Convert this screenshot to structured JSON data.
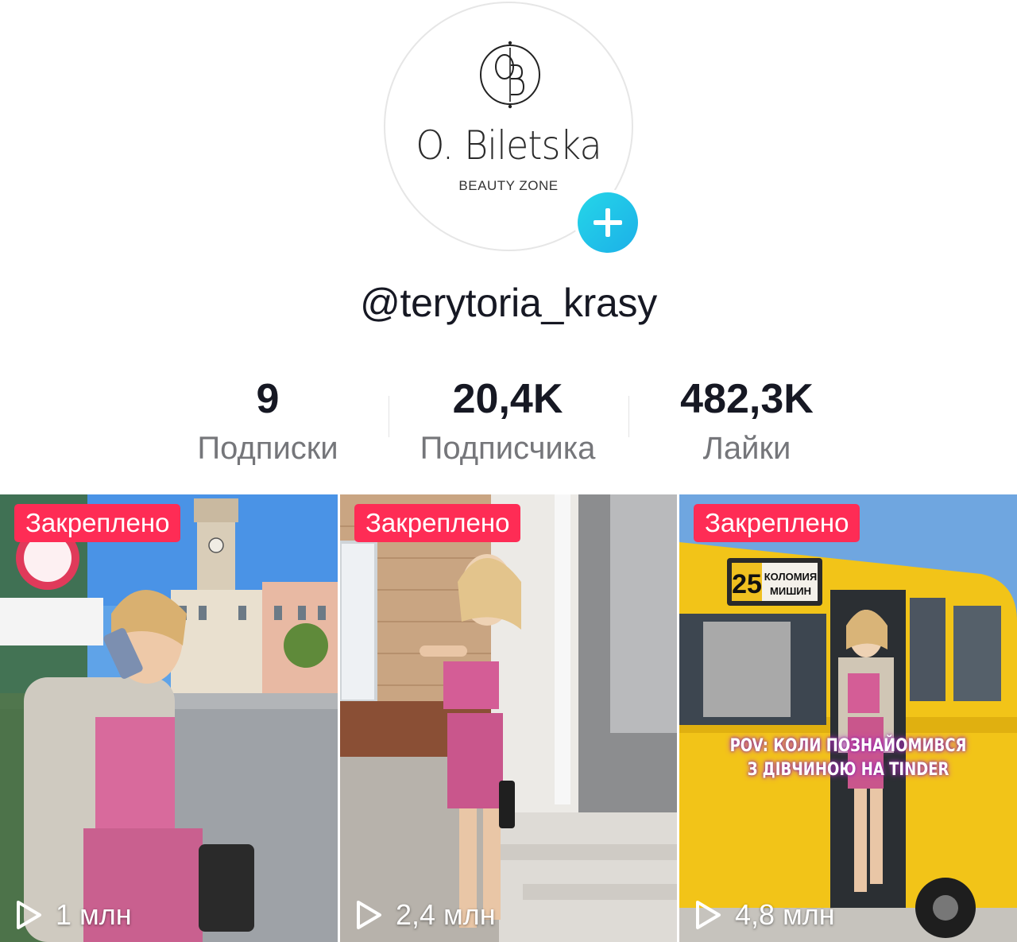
{
  "profile": {
    "logo_monogram": "OB",
    "logo_name": "O. Biletska",
    "logo_subtitle": "BEAUTY ZONE",
    "username": "@terytoria_krasy"
  },
  "stats": [
    {
      "value": "9",
      "label": "Подписки"
    },
    {
      "value": "20,4K",
      "label": "Подписчика"
    },
    {
      "value": "482,3K",
      "label": "Лайки"
    }
  ],
  "videos": [
    {
      "pinned_label": "Закреплено",
      "views": "1 млн",
      "overlay_text": ""
    },
    {
      "pinned_label": "Закреплено",
      "views": "2,4 млн",
      "overlay_text": ""
    },
    {
      "pinned_label": "Закреплено",
      "views": "4,8 млн",
      "overlay_text_line1": "POV: КОЛИ ПОЗНАЙОМИВСЯ",
      "overlay_text_line2": "З ДІВЧИНОЮ НА TINDER",
      "bus_route_number": "25",
      "bus_route_line1": "КОЛОМИЯ",
      "bus_route_line2": "МИШИН"
    }
  ],
  "colors": {
    "pinned_badge": "#fe2c55",
    "follow_button": "#20c5e8",
    "stat_label": "#75767a"
  },
  "icons": {
    "follow": "plus-icon",
    "views": "play-outline-icon"
  }
}
